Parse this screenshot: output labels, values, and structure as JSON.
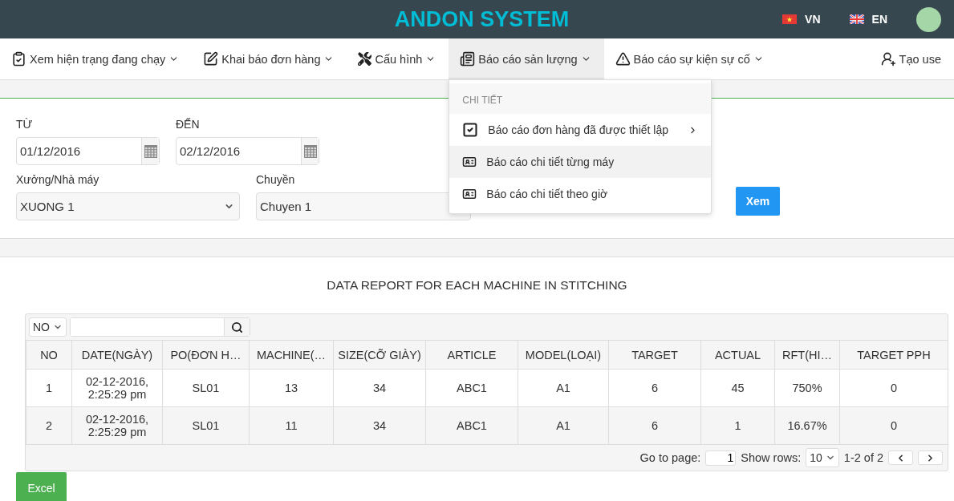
{
  "header": {
    "title": "ANDON SYSTEM",
    "languages": [
      {
        "code": "VN",
        "kind": "vn"
      },
      {
        "code": "EN",
        "kind": "uk"
      }
    ]
  },
  "nav": [
    {
      "label": "Xem hiện trạng đang chạy",
      "kind": "clipboard",
      "caret": true,
      "selected": false
    },
    {
      "label": "Khai báo đơn hàng",
      "kind": "edit",
      "caret": true,
      "selected": false
    },
    {
      "label": "Cấu hình",
      "kind": "tools",
      "caret": true,
      "selected": false
    },
    {
      "label": "Báo cáo sản lượng",
      "kind": "news",
      "caret": true,
      "selected": true,
      "menu": {
        "heading": "CHI TIẾT",
        "items": [
          {
            "label": "Báo cáo đơn hàng đã được thiết lập",
            "kind": "check",
            "submenu": true,
            "selected": false
          },
          {
            "label": "Báo cáo chi tiết từng máy",
            "kind": "card",
            "submenu": false,
            "selected": true
          },
          {
            "label": "Báo cáo chi tiết theo giờ",
            "kind": "card",
            "submenu": false,
            "selected": false
          }
        ]
      }
    },
    {
      "label": "Báo cáo sự kiện sự cố",
      "kind": "alert",
      "caret": true,
      "selected": false
    },
    {
      "label": "Tạo use",
      "kind": "user-add",
      "caret": false,
      "selected": false
    }
  ],
  "filters": {
    "from": {
      "label": "TỪ",
      "value": "01/12/2016"
    },
    "to": {
      "label": "ĐẾN",
      "value": "02/12/2016"
    },
    "selects": [
      {
        "label": "Xưởng/Nhà máy",
        "value": "XUONG 1"
      },
      {
        "label": "Chuyền",
        "value": "Chuyen 1"
      }
    ],
    "submit": "Xem"
  },
  "report": {
    "title": "DATA REPORT FOR EACH MACHINE IN STITCHING",
    "column_select": "NO",
    "columns": [
      "NO",
      "DATE(NGÀY)",
      "PO(ĐƠN H…",
      "MACHINE(…",
      "SIZE(CỠ GIÀY)",
      "ARTICLE",
      "MODEL(LOẠI)",
      "TARGET",
      "ACTUAL",
      "RFT(HI…",
      "TARGET PPH"
    ],
    "rows": [
      [
        "1",
        "02-12-2016, 2:25:29 pm",
        "SL01",
        "13",
        "34",
        "ABC1",
        "A1",
        "6",
        "45",
        "750%",
        "0"
      ],
      [
        "2",
        "02-12-2016, 2:25:29 pm",
        "SL01",
        "11",
        "34",
        "ABC1",
        "A1",
        "6",
        "1",
        "16.67%",
        "0"
      ]
    ],
    "pagination": {
      "goto_label": "Go to page:",
      "page": "1",
      "rows_label": "Show rows:",
      "rows": "10",
      "range": "1-2 of 2"
    }
  },
  "excel_button": "Excel"
}
